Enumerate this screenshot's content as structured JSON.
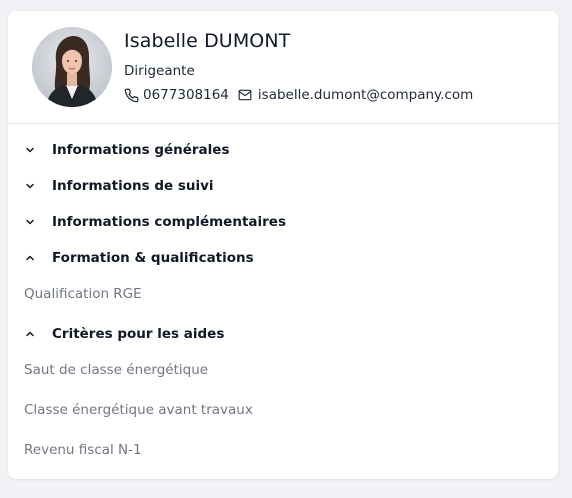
{
  "profile": {
    "name": "Isabelle DUMONT",
    "role": "Dirigeante",
    "phone": "0677308164",
    "email": "isabelle.dumont@company.com",
    "avatar_icon": "person-photo"
  },
  "sections": [
    {
      "label": "Informations générales",
      "state": "collapsed",
      "icon": "chevron-down-icon"
    },
    {
      "label": "Informations de suivi",
      "state": "collapsed",
      "icon": "chevron-down-icon"
    },
    {
      "label": "Informations complémentaires",
      "state": "collapsed",
      "icon": "chevron-down-icon"
    },
    {
      "label": "Formation & qualifications",
      "state": "expanded",
      "icon": "chevron-up-icon",
      "fields": [
        "Qualification RGE"
      ]
    },
    {
      "label": "Critères pour les aides",
      "state": "expanded",
      "icon": "chevron-up-icon",
      "fields": [
        "Saut de classe énergétique",
        "Classe énergétique avant travaux",
        "Revenu fiscal N-1"
      ]
    }
  ],
  "colors": {
    "text_primary": "#111827",
    "text_muted": "#717784",
    "divider": "#e3e5e9",
    "page_bg": "#f1f2f5"
  }
}
